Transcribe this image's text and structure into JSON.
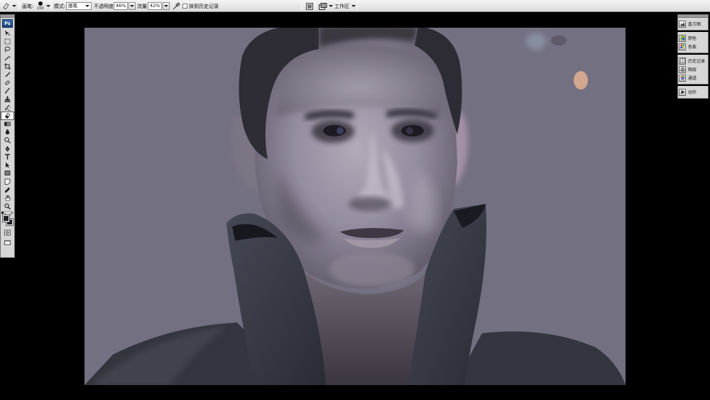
{
  "options_bar": {
    "brush_label": "画笔:",
    "brush_size": "150",
    "mode_label": "模式:",
    "mode_value": "画笔",
    "opacity_label": "不透明度:",
    "opacity_value": "46%",
    "flow_label": "流量:",
    "flow_value": "42%",
    "erase_history_label": "抹到历史记录",
    "workspace_label": "工作区"
  },
  "tools_panel": {
    "logo": "Ps",
    "tools": [
      "move-tool",
      "marquee-tool",
      "lasso-tool",
      "magic-wand-tool",
      "crop-tool",
      "slice-tool",
      "healing-brush-tool",
      "brush-tool",
      "clone-stamp-tool",
      "history-brush-tool",
      "eraser-tool",
      "gradient-tool",
      "blur-tool",
      "dodge-tool",
      "pen-tool",
      "type-tool",
      "path-selection-tool",
      "shape-tool",
      "notes-tool",
      "eyedropper-tool",
      "hand-tool",
      "zoom-tool"
    ],
    "active_tool": "eraser-tool",
    "foreground_color": "#1e1f26",
    "background_color": "#1a1b22"
  },
  "dock": {
    "groups": [
      [
        {
          "label": "直方图",
          "icon": "histogram-icon"
        }
      ],
      [
        {
          "label": "颜色",
          "icon": "color-icon"
        },
        {
          "label": "色板",
          "icon": "swatches-icon"
        }
      ],
      [
        {
          "label": "历史记录",
          "icon": "history-icon"
        },
        {
          "label": "图层",
          "icon": "layers-icon"
        },
        {
          "label": "通道",
          "icon": "channels-icon"
        }
      ],
      [
        {
          "label": "动作",
          "icon": "actions-icon"
        }
      ]
    ]
  },
  "canvas": {
    "background_color": "#737082",
    "content": "digital-painting-portrait"
  }
}
